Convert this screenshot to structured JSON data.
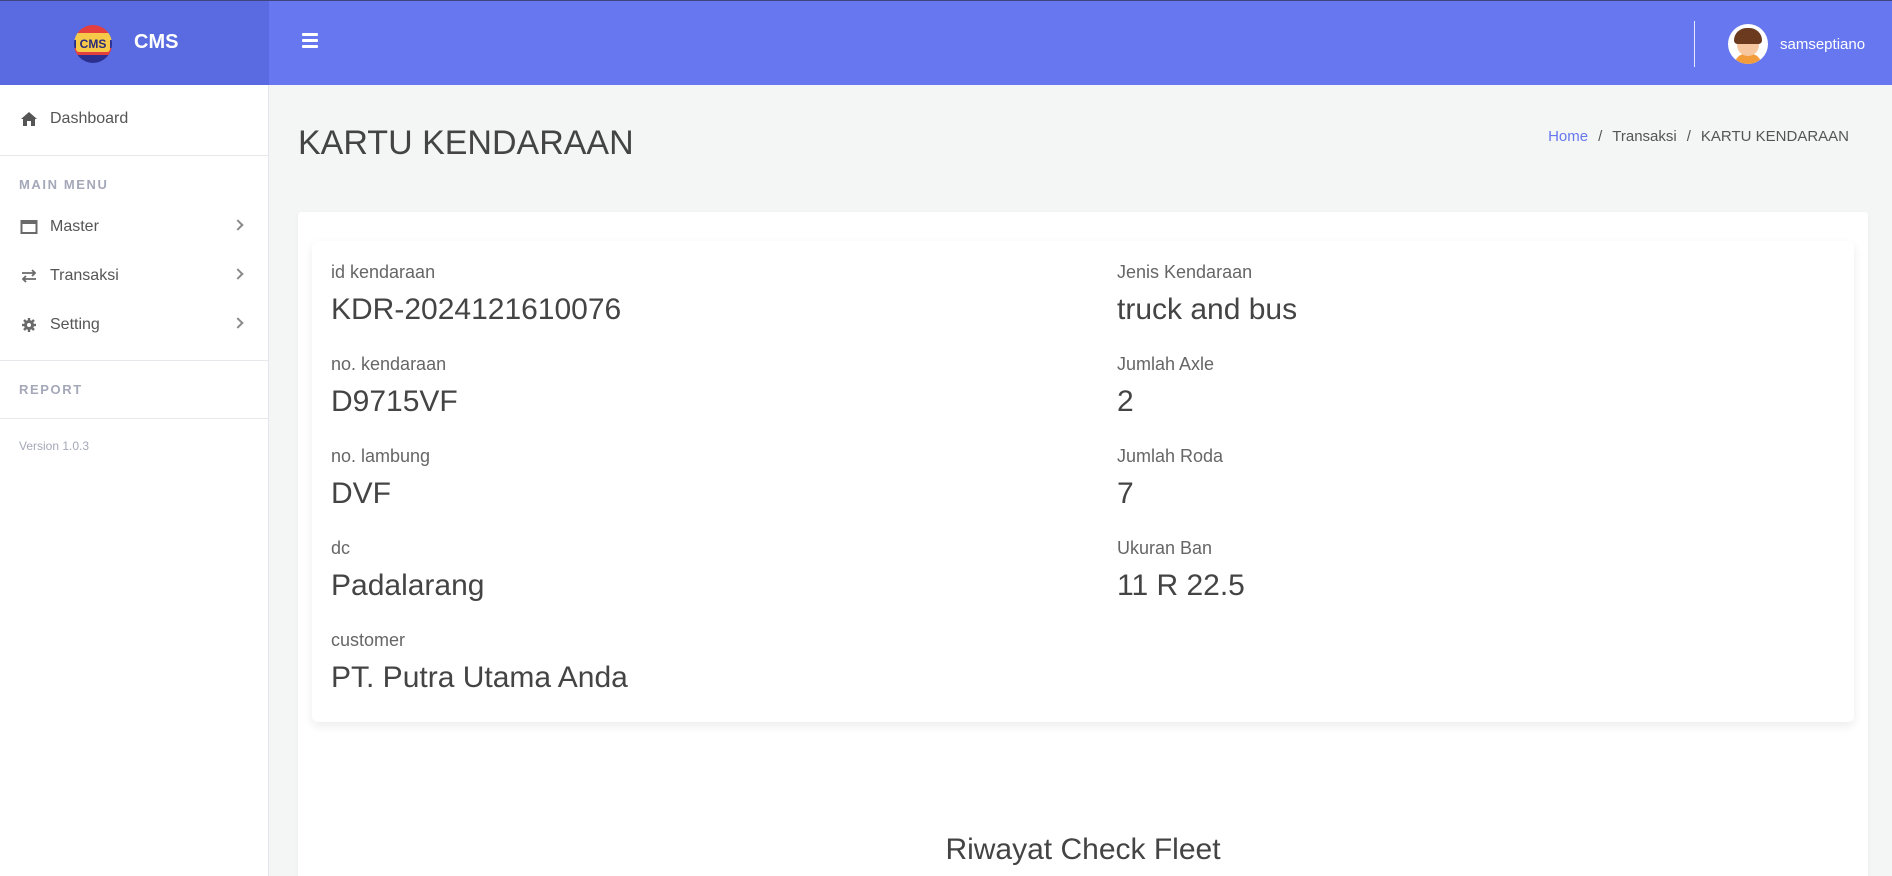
{
  "brand": {
    "name": "CMS",
    "logo_text": "CMS"
  },
  "topbar": {
    "menu_icon": "hamburger-icon",
    "username": "samseptiano"
  },
  "sidebar": {
    "dashboard": "Dashboard",
    "main_menu_header": "MAIN MENU",
    "items": [
      {
        "label": "Master",
        "icon": "window-icon"
      },
      {
        "label": "Transaksi",
        "icon": "exchange-icon"
      },
      {
        "label": "Setting",
        "icon": "gear-icon"
      }
    ],
    "report_header": "REPORT",
    "version": "Version 1.0.3"
  },
  "page": {
    "title": "KARTU KENDARAAN",
    "breadcrumb": [
      "Home",
      "Transaksi",
      "KARTU KENDARAAN"
    ],
    "breadcrumb_sep": "/"
  },
  "vehicle": {
    "left": [
      {
        "label": "id kendaraan",
        "value": "KDR-2024121610076"
      },
      {
        "label": "no. kendaraan",
        "value": "D9715VF"
      },
      {
        "label": "no. lambung",
        "value": "DVF"
      },
      {
        "label": "dc",
        "value": "Padalarang"
      },
      {
        "label": "customer",
        "value": "PT. Putra Utama Anda"
      }
    ],
    "right": [
      {
        "label": "Jenis Kendaraan",
        "value": "truck and bus"
      },
      {
        "label": "Jumlah Axle",
        "value": "2"
      },
      {
        "label": "Jumlah Roda",
        "value": "7"
      },
      {
        "label": "Ukuran Ban",
        "value": "11 R 22.5"
      }
    ]
  },
  "history": {
    "title": "Riwayat Check Fleet"
  },
  "colors": {
    "primary": "#6777ef",
    "brand_bg": "#5a6ae0"
  }
}
